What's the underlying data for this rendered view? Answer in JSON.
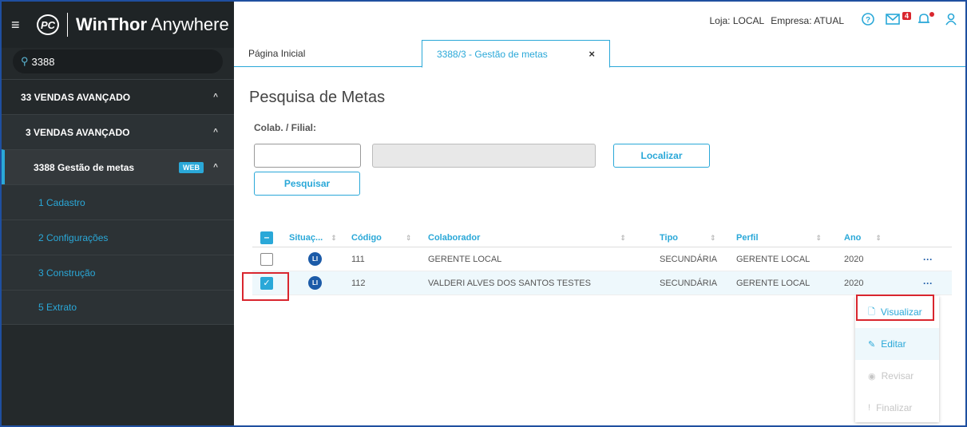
{
  "app": {
    "logo_text": "PC",
    "brand_bold": "WinThor",
    "brand_light": " Anywhere",
    "search_value": "3388"
  },
  "sidebar": {
    "items": [
      {
        "label": "33  VENDAS AVANÇADO"
      },
      {
        "label": "3  VENDAS AVANÇADO"
      },
      {
        "label": "3388  Gestão de metas",
        "badge": "WEB"
      },
      {
        "label": "1  Cadastro"
      },
      {
        "label": "2  Configurações"
      },
      {
        "label": "3  Construção"
      },
      {
        "label": "5  Extrato"
      }
    ]
  },
  "topbar": {
    "loja": "Loja: LOCAL",
    "empresa": "Empresa: ATUAL",
    "mail_count": "4"
  },
  "tabs": [
    {
      "label": "Página Inicial"
    },
    {
      "label": "3388/3 - Gestão de metas"
    }
  ],
  "page": {
    "title": "Pesquisa de Metas",
    "colab_label": "Colab. / Filial:",
    "localizar_label": "Localizar",
    "pesquisar_label": "Pesquisar"
  },
  "table": {
    "headers": {
      "situacao": "Situaç...",
      "codigo": "Código",
      "colaborador": "Colaborador",
      "tipo": "Tipo",
      "perfil": "Perfil",
      "ano": "Ano"
    },
    "rows": [
      {
        "situacao": "LI",
        "codigo": "111",
        "colaborador": "GERENTE LOCAL",
        "tipo": "SECUNDÁRIA",
        "perfil": "GERENTE LOCAL",
        "ano": "2020",
        "checked": false
      },
      {
        "situacao": "LI",
        "codigo": "112",
        "colaborador": "VALDERI ALVES DOS SANTOS TESTES",
        "tipo": "SECUNDÁRIA",
        "perfil": "GERENTE LOCAL",
        "ano": "2020",
        "checked": true
      }
    ]
  },
  "context_menu": {
    "visualizar": "Visualizar",
    "editar": "Editar",
    "revisar": "Revisar",
    "finalizar": "Finalizar"
  },
  "colors": {
    "accent": "#2aa8d8",
    "sidebar_bg": "#24292b",
    "highlight": "#d9262e"
  }
}
